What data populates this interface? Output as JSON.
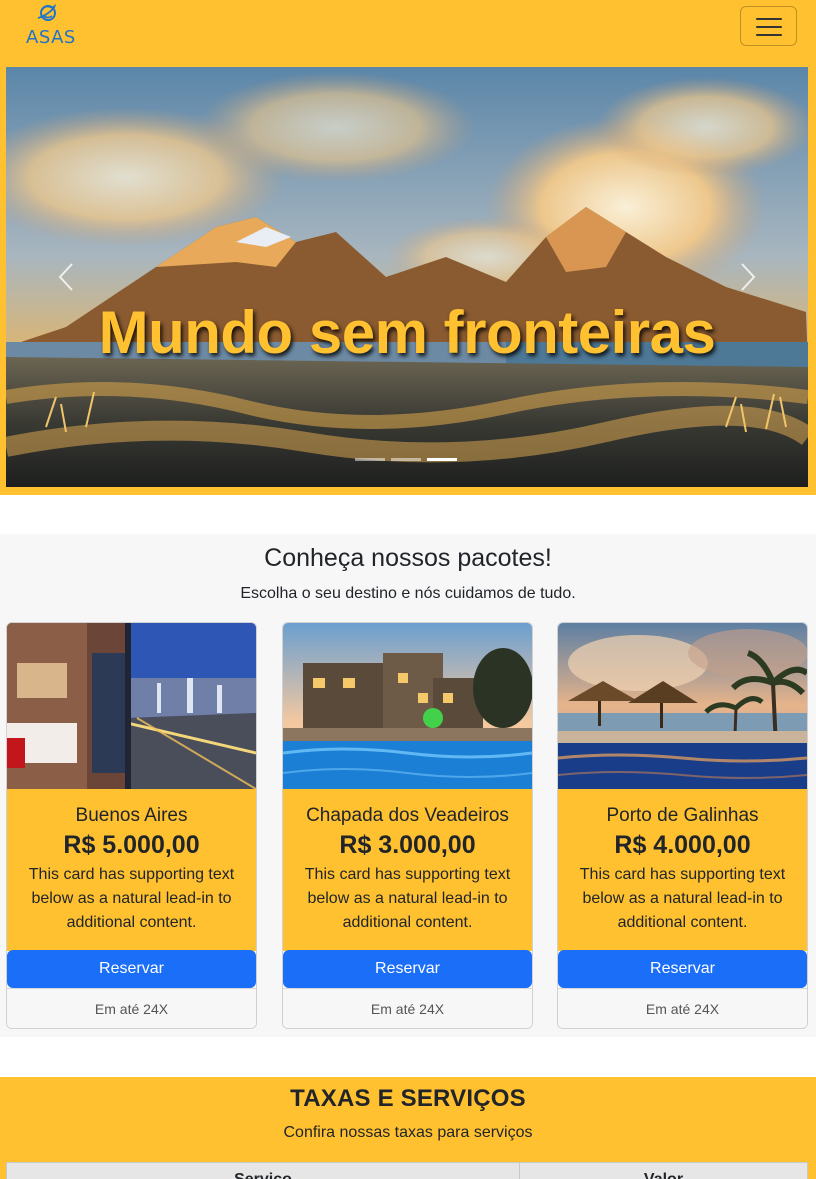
{
  "navbar": {
    "brand": "ASAS",
    "toggler_label": "Toggle navigation"
  },
  "hero": {
    "caption": "Mundo sem fronteiras",
    "slides": [
      "slide-1",
      "slide-2",
      "slide-3"
    ],
    "active_slide": 3
  },
  "packages": {
    "title": "Conheça nossos pacotes!",
    "subtitle": "Escolha o seu destino e nós cuidamos de tudo.",
    "cards": [
      {
        "destination": "Buenos Aires",
        "price": "R$ 5.000,00",
        "text": "This card has supporting text below as a natural lead-in to additional content.",
        "button": "Reservar",
        "footer": "Em até 24X"
      },
      {
        "destination": "Chapada dos Veadeiros",
        "price": "R$ 3.000,00",
        "text": "This card has supporting text below as a natural lead-in to additional content.",
        "button": "Reservar",
        "footer": "Em até 24X"
      },
      {
        "destination": "Porto de Galinhas",
        "price": "R$ 4.000,00",
        "text": "This card has supporting text below as a natural lead-in to additional content.",
        "button": "Reservar",
        "footer": "Em até 24X"
      }
    ]
  },
  "taxes": {
    "title": "TAXAS E SERVIÇOS",
    "subtitle": "Confira nossas taxas para serviços",
    "table_headers": [
      "Serviço",
      "Valor"
    ]
  },
  "colors": {
    "brand_yellow": "#ffc12f",
    "button_blue": "#1a6ef7",
    "logo_blue": "#1f74c9"
  }
}
